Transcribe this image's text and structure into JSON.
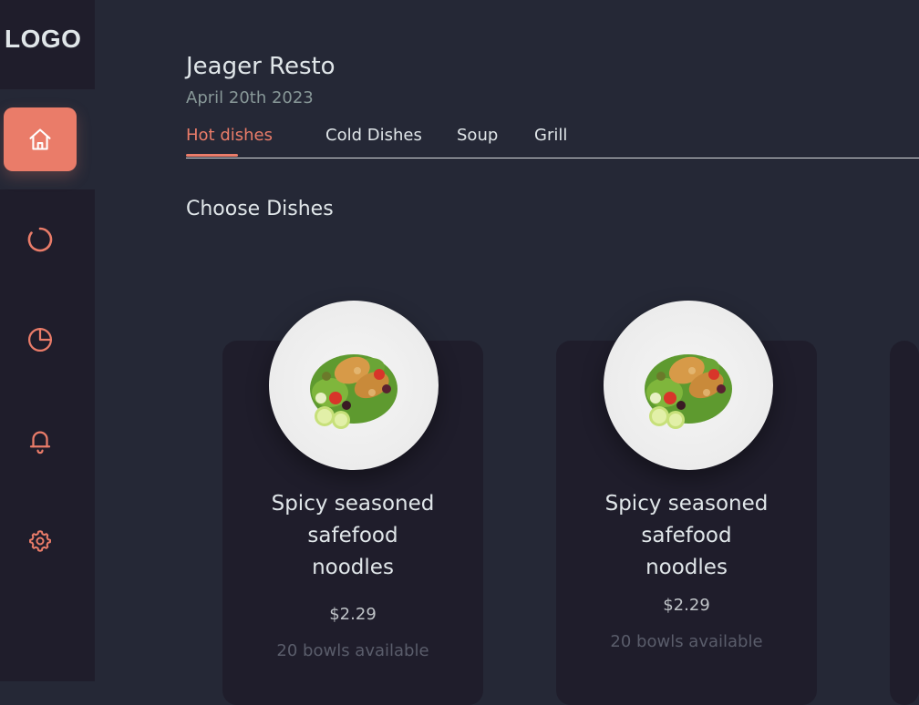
{
  "sidebar": {
    "logo": "LOGO",
    "items": [
      {
        "icon": "home-icon",
        "active": true
      },
      {
        "icon": "discount-icon",
        "active": false
      },
      {
        "icon": "pie-chart-icon",
        "active": false
      },
      {
        "icon": "bell-icon",
        "active": false
      },
      {
        "icon": "gear-icon",
        "active": false
      }
    ]
  },
  "header": {
    "title": "Jeager Resto",
    "date": "April 20th 2023"
  },
  "tabs": [
    {
      "label": "Hot dishes",
      "active": true
    },
    {
      "label": "Cold Dishes",
      "active": false
    },
    {
      "label": "Soup",
      "active": false
    },
    {
      "label": "Grill",
      "active": false
    }
  ],
  "section": {
    "title": "Choose Dishes"
  },
  "dishes": [
    {
      "name_line1": "Spicy seasoned",
      "name_line2": "safefood",
      "name_line3": "noodles",
      "price": "$2.29",
      "availability": "20 bowls available"
    },
    {
      "name_line1": "Spicy seasoned",
      "name_line2": "safefood",
      "name_line3": "noodles",
      "price": "$2.29",
      "availability": "20 bowls available"
    }
  ],
  "colors": {
    "accent": "#ea7c69",
    "background": "#252836",
    "panel": "#1f1d2b",
    "text": "#e0e6e9",
    "muted": "#889898"
  }
}
